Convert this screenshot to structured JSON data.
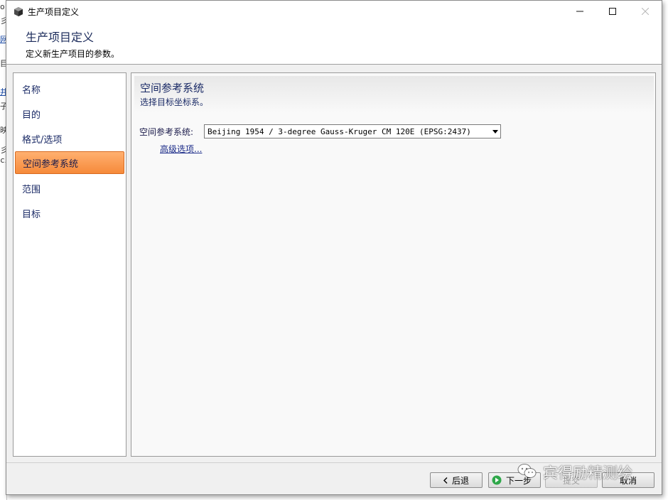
{
  "window": {
    "title": "生产项目定义",
    "minimize_glyph": "─",
    "maximize_glyph": "☐",
    "close_glyph": "✕"
  },
  "header": {
    "title": "生产项目定义",
    "subtitle": "定义新生产项目的参数。"
  },
  "nav": {
    "items": [
      {
        "label": "名称",
        "active": false
      },
      {
        "label": "目的",
        "active": false
      },
      {
        "label": "格式/选项",
        "active": false
      },
      {
        "label": "空间参考系统",
        "active": true
      },
      {
        "label": "范围",
        "active": false
      },
      {
        "label": "目标",
        "active": false
      }
    ]
  },
  "content": {
    "title": "空间参考系统",
    "subtitle": "选择目标坐标系。",
    "srs_label": "空间参考系统:",
    "srs_value": "Beijing 1954 / 3-degree Gauss-Kruger CM 120E (EPSG:2437)",
    "advanced_link": "高级选项..."
  },
  "footer": {
    "back_label": "后退",
    "next_label": "下一步",
    "submit_label": "提交",
    "cancel_label": "取消"
  },
  "watermark": {
    "text": "宾得励精测绘"
  },
  "background_app": {
    "glyphs": [
      "or",
      "彡",
      "网",
      "目",
      "井",
      "子",
      "映",
      "彡",
      "ci"
    ]
  },
  "colors": {
    "active_nav": "#f68a3a",
    "title_text": "#1a2a66",
    "next_icon": "#2fa84a"
  }
}
